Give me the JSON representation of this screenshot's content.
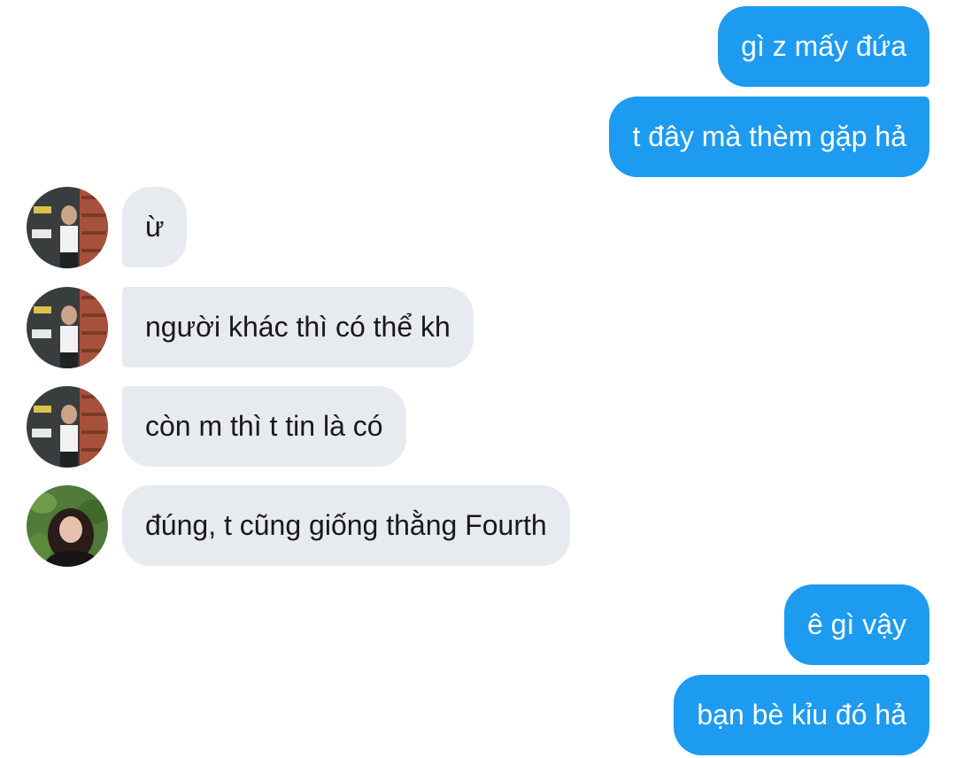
{
  "messages": {
    "m1": {
      "text": "gì z mấy đứa",
      "direction": "sent"
    },
    "m2": {
      "text": "t đây mà thèm gặp hả",
      "direction": "sent"
    },
    "m3": {
      "text": "ừ",
      "direction": "received",
      "avatar": "avatar-man"
    },
    "m4": {
      "text": "người khác thì có thể kh",
      "direction": "received",
      "avatar": "avatar-man"
    },
    "m5": {
      "text": "còn m thì t tin là có",
      "direction": "received",
      "avatar": "avatar-man"
    },
    "m6": {
      "text": "đúng, t cũng giống thằng Fourth",
      "direction": "received",
      "avatar": "avatar-woman"
    },
    "m7": {
      "text": "ê gì vậy",
      "direction": "sent"
    },
    "m8": {
      "text": "bạn bè kỉu đó hả",
      "direction": "sent"
    }
  },
  "colors": {
    "sent_bubble": "#1d9bf0",
    "received_bubble": "#e7ebf0",
    "background": "#ffffff"
  }
}
